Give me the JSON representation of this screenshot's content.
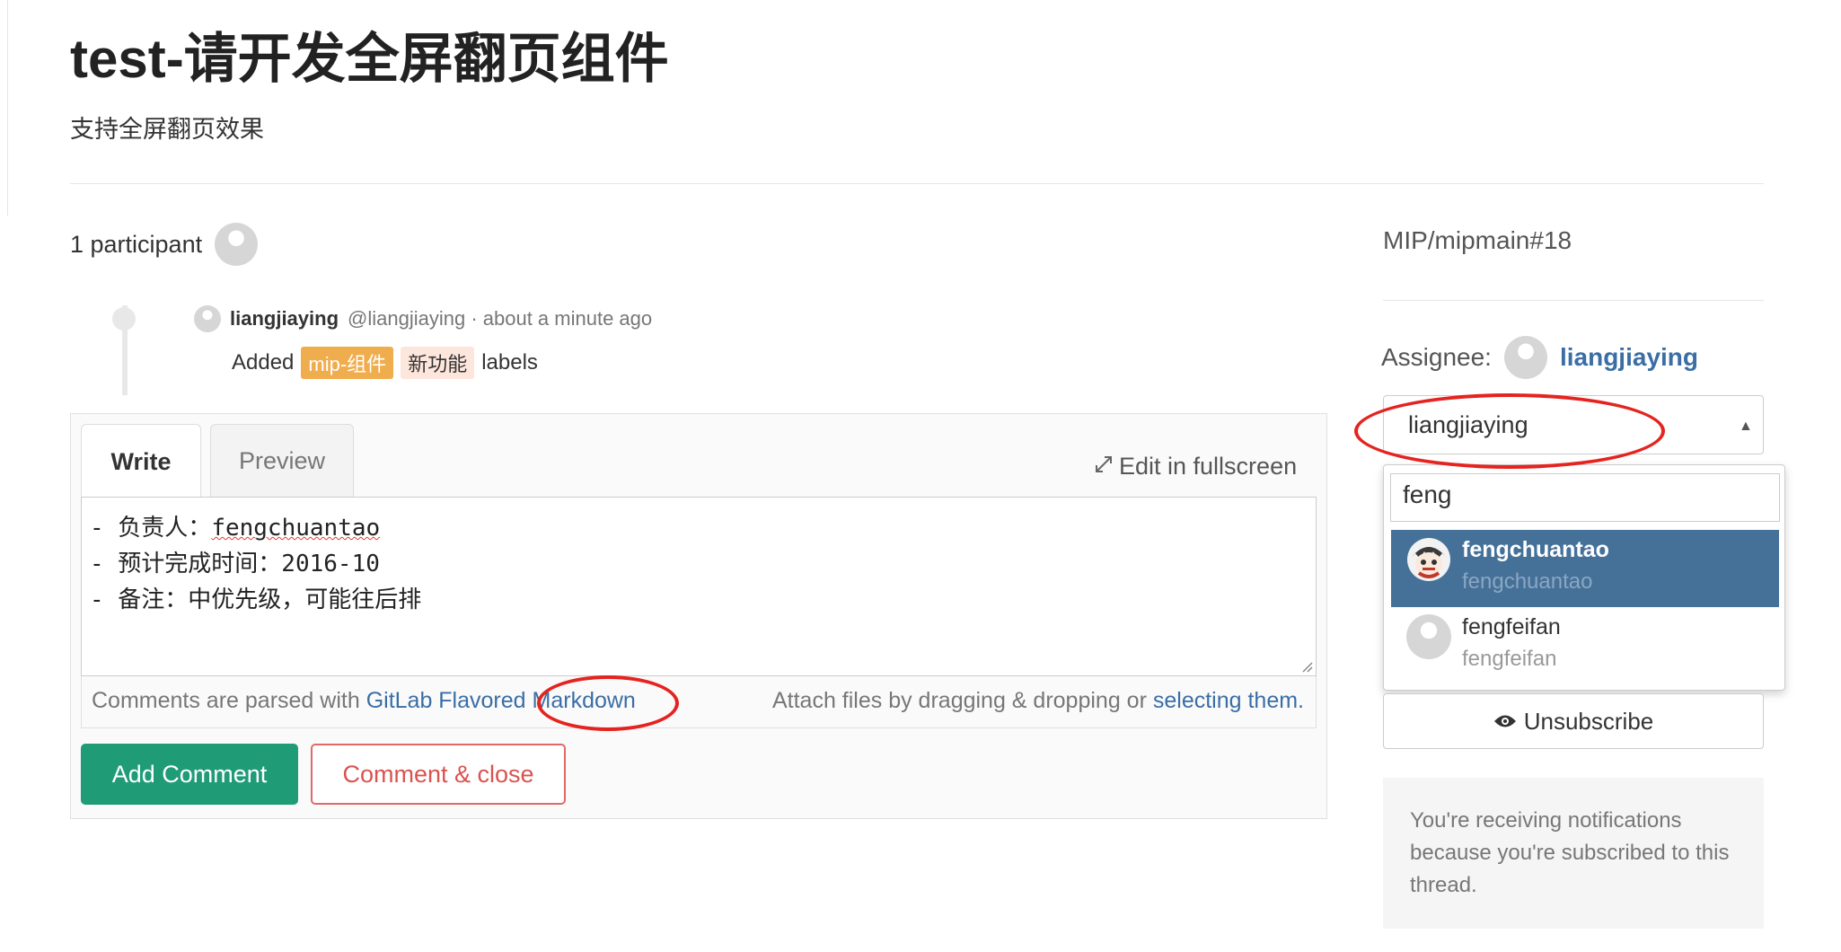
{
  "issue": {
    "title": "test-请开发全屏翻页组件",
    "description": "支持全屏翻页效果"
  },
  "participants": {
    "label": "1 participant"
  },
  "activity": {
    "author": "liangjiaying",
    "handle": "@liangjiaying · about a minute ago",
    "prefix": "Added",
    "labels": [
      "mip-组件",
      "新功能"
    ],
    "suffix": "labels",
    "label_colors": [
      "#f0ad4e",
      "#fde6dc"
    ]
  },
  "comment_form": {
    "tab_write": "Write",
    "tab_preview": "Preview",
    "fullscreen": "Edit in fullscreen",
    "lines": [
      "- 负责人：",
      "- 预计完成时间：2016-10",
      "- 备注：中优先级，可能往后排"
    ],
    "assignee_text": "fengchuantao",
    "footer_prefix": "Comments are parsed with ",
    "footer_link1": "GitLab Flavored",
    "footer_link2": "Markdown",
    "attach_prefix": "Attach files by dragging & dropping or ",
    "attach_link": "selecting them.",
    "add_comment": "Add Comment",
    "comment_close": "Comment & close"
  },
  "sidebar": {
    "reference": "MIP/mipmain#18",
    "assignee_label": "Assignee:",
    "assignee_name": "liangjiaying",
    "select_value": "liangjiaying",
    "search_value": "feng",
    "options": [
      {
        "name": "fengchuantao",
        "username": "fengchuantao",
        "active": true
      },
      {
        "name": "fengfeifan",
        "username": "fengfeifan",
        "active": false
      }
    ],
    "unsubscribe": "Unsubscribe",
    "notice": "You're receiving notifications because you're subscribed to this thread."
  },
  "colors": {
    "primary": "#1f9c76",
    "danger": "#d9534f",
    "link": "#3a6ea5",
    "selected_option": "#457199",
    "annotation": "#e5231f"
  }
}
